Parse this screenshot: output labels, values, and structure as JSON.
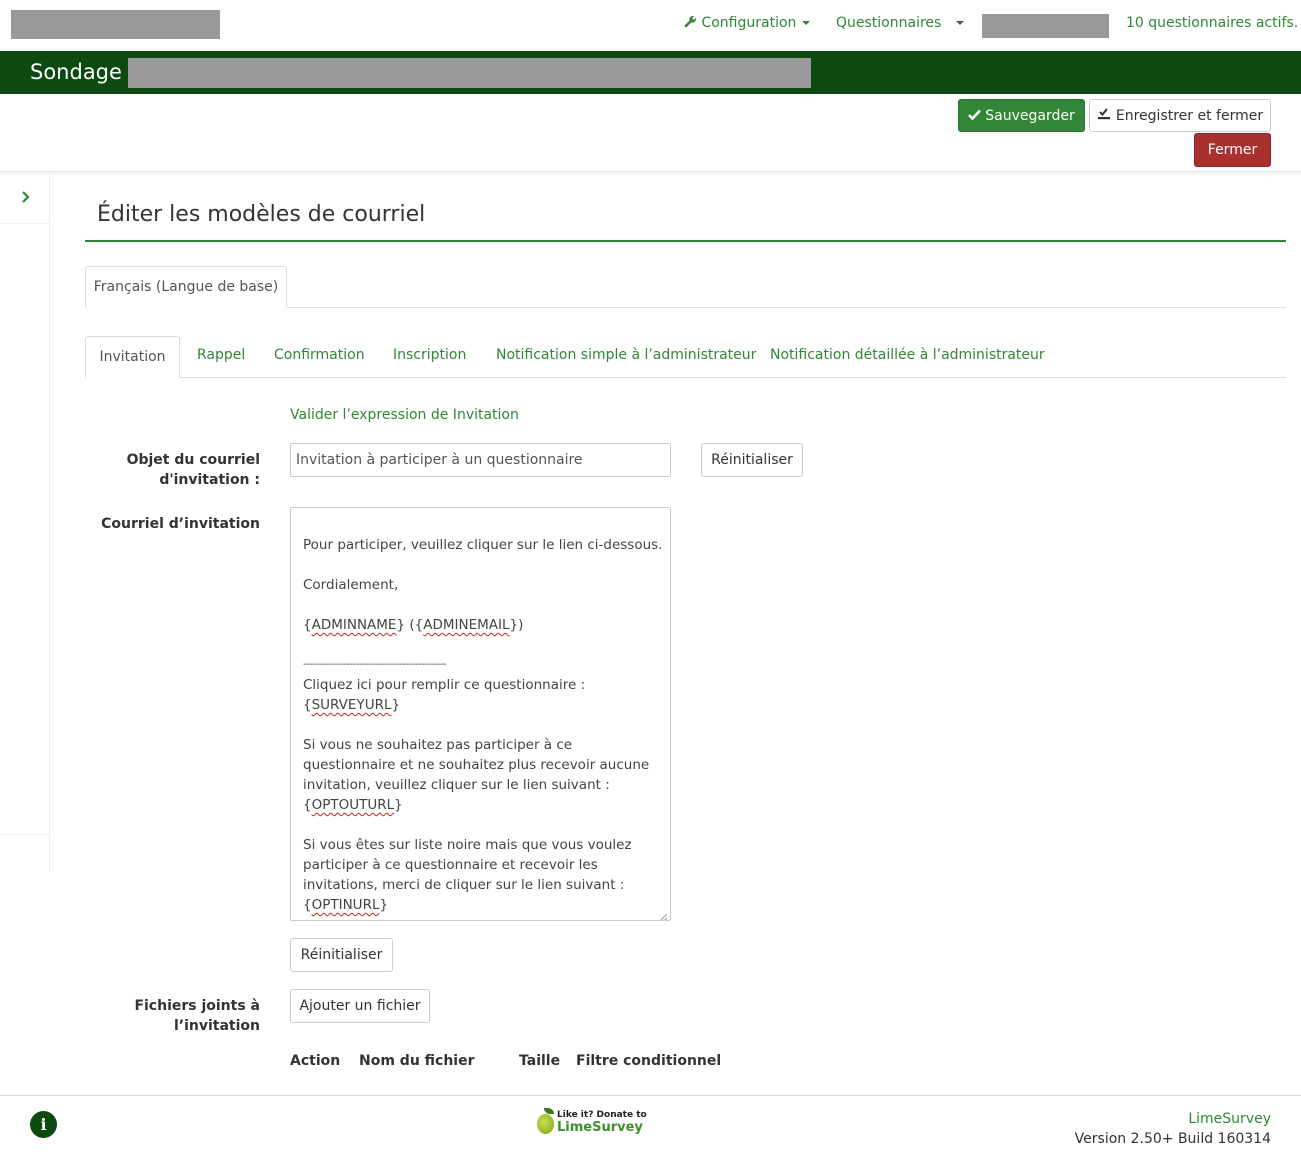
{
  "topbar": {
    "configuration_label": "Configuration",
    "surveys_label": "Questionnaires",
    "active_surveys": "10 questionnaires actifs."
  },
  "survey": {
    "title_prefix": "Sondage :"
  },
  "actions": {
    "save": "Sauvegarder",
    "save_close": "Enregistrer et fermer",
    "close": "Fermer"
  },
  "page": {
    "title": "Éditer les modèles de courriel"
  },
  "language_tabs": [
    "Français (Langue de base)"
  ],
  "email_tabs": [
    "Invitation",
    "Rappel",
    "Confirmation",
    "Inscription",
    "Notification simple à l’administrateur",
    "Notification détaillée à l’administrateur"
  ],
  "form": {
    "validate_link": "Valider l’expression de Invitation",
    "subject_label_line1": "Objet du courriel",
    "subject_label_line2": "d'invitation :",
    "subject_value": "Invitation à participer à un questionnaire",
    "reset_label": "Réinitialiser",
    "body_label": "Courriel d’invitation",
    "body_lines": {
      "l1": "Pour participer, veuillez cliquer sur le lien ci-dessous.",
      "l2": "Cordialement,",
      "l3a": "{",
      "l3b": "ADMINNAME",
      "l3c": "} ({",
      "l3d": "ADMINEMAIL",
      "l3e": "})",
      "l4": "----------------------------------------------",
      "l5": "Cliquez ici pour remplir ce questionnaire :",
      "l6a": "{",
      "l6b": "SURVEYURL",
      "l6c": "}",
      "l7": "Si vous ne souhaitez pas participer à ce",
      "l8": "questionnaire et ne souhaitez plus recevoir aucune",
      "l9": "invitation, veuillez cliquer sur le lien suivant :",
      "l10a": "{",
      "l10b": "OPTOUTURL",
      "l10c": "}",
      "l11": "Si vous êtes sur liste noire mais que vous voulez",
      "l12": "participer à ce questionnaire et recevoir les",
      "l13": "invitations, merci de cliquer sur le lien suivant :",
      "l14a": "{",
      "l14b": "OPTINURL",
      "l14c": "}"
    },
    "attachments_label_line1": "Fichiers joints à",
    "attachments_label_line2": "l’invitation",
    "add_file": "Ajouter un fichier",
    "columns": [
      "Action",
      "Nom du fichier",
      "Taille",
      "Filtre conditionnel"
    ]
  },
  "footer": {
    "donate_small": "Like it? Donate to",
    "donate_big": "LimeSurvey",
    "brand": "LimeSurvey",
    "version": "Version 2.50+ Build 160314"
  },
  "colors": {
    "accent": "#328637",
    "header_dark": "#0d4a10",
    "danger": "#a8312f"
  }
}
